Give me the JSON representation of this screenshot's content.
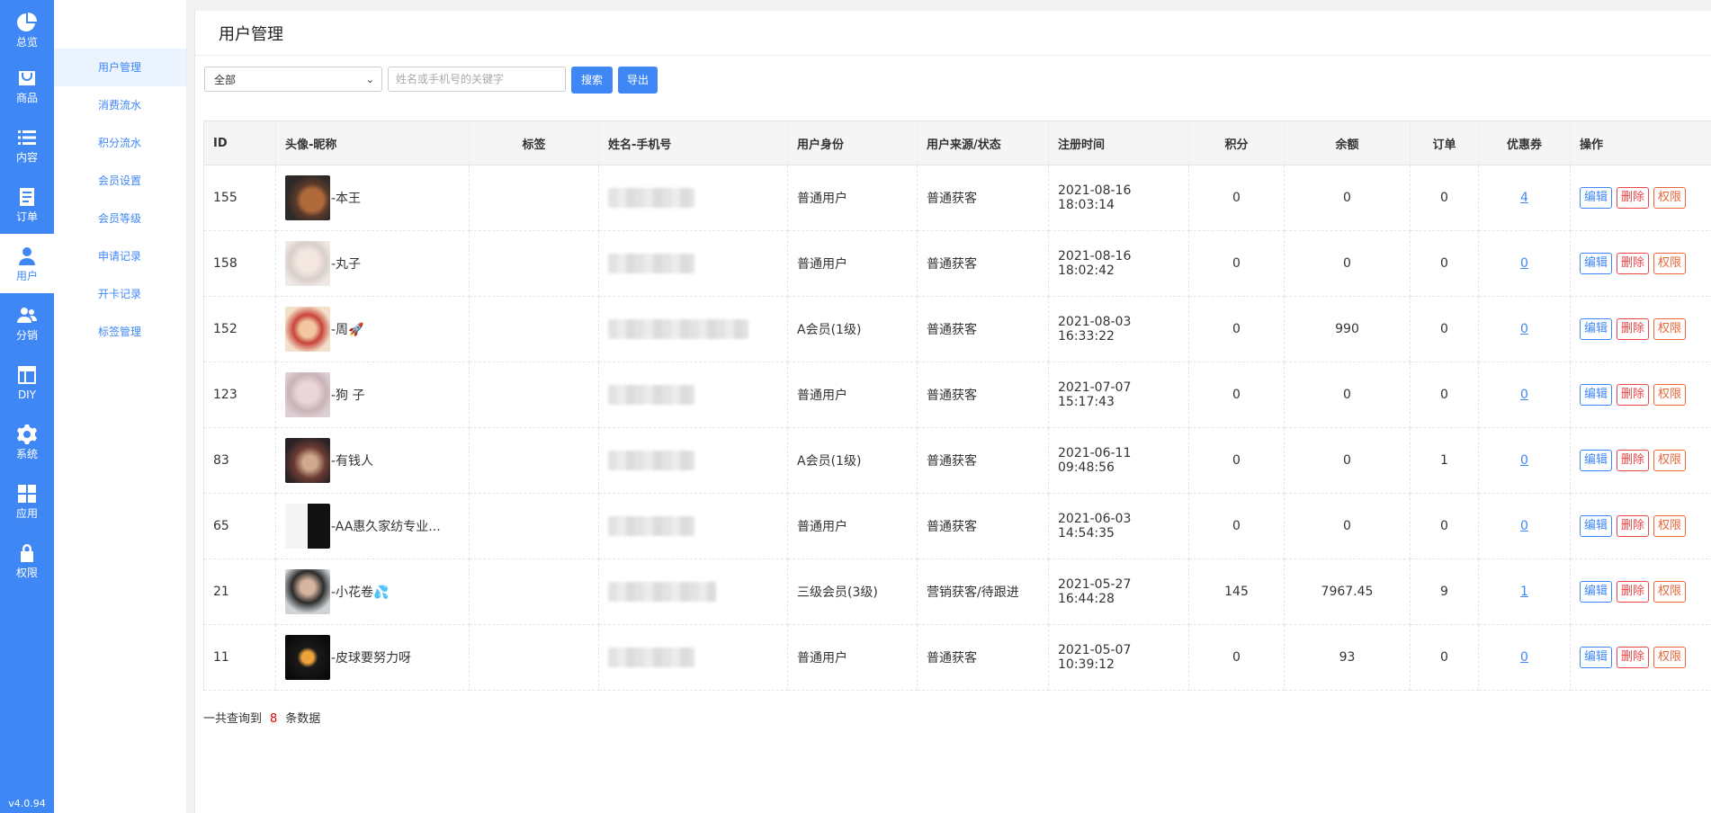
{
  "nav": {
    "items": [
      {
        "label": "总览",
        "icon": "dashboard-icon"
      },
      {
        "label": "商品",
        "icon": "goods-icon"
      },
      {
        "label": "内容",
        "icon": "list-icon"
      },
      {
        "label": "订单",
        "icon": "order-icon"
      },
      {
        "label": "用户",
        "icon": "user-icon",
        "active": true
      },
      {
        "label": "分销",
        "icon": "team-icon"
      },
      {
        "label": "DIY",
        "icon": "layout-icon"
      },
      {
        "label": "系统",
        "icon": "gear-icon"
      },
      {
        "label": "应用",
        "icon": "apps-icon"
      },
      {
        "label": "权限",
        "icon": "lock-icon"
      }
    ],
    "version": "v4.0.94",
    "accent": "#3f87f5"
  },
  "submenu": {
    "items": [
      "用户管理",
      "消费流水",
      "积分流水",
      "会员设置",
      "会员等级",
      "申请记录",
      "开卡记录",
      "标签管理"
    ]
  },
  "page": {
    "title": "用户管理",
    "filter_value": "全部",
    "search_placeholder": "姓名或手机号的关键字",
    "search_label": "搜索",
    "export_label": "导出"
  },
  "table": {
    "headers": [
      "ID",
      "头像-昵称",
      "标签",
      "姓名-手机号",
      "用户身份",
      "用户来源/状态",
      "注册时间",
      "积分",
      "余额",
      "订单",
      "优惠券",
      "操作"
    ],
    "actions": {
      "edit": "编辑",
      "delete": "删除",
      "perm": "权限"
    },
    "rows": [
      {
        "id": "155",
        "nick": "-本王",
        "role": "普通用户",
        "source": "普通获客",
        "time": "2021-08-16 18:03:14",
        "points": "0",
        "balance": "0",
        "orders": "0",
        "coupons": "4"
      },
      {
        "id": "158",
        "nick": "-丸子",
        "role": "普通用户",
        "source": "普通获客",
        "time": "2021-08-16 18:02:42",
        "points": "0",
        "balance": "0",
        "orders": "0",
        "coupons": "0"
      },
      {
        "id": "152",
        "nick": "-周🚀",
        "role": "A会员(1级)",
        "source": "普通获客",
        "time": "2021-08-03 16:33:22",
        "points": "0",
        "balance": "990",
        "orders": "0",
        "coupons": "0"
      },
      {
        "id": "123",
        "nick": "-狗 子",
        "role": "普通用户",
        "source": "普通获客",
        "time": "2021-07-07 15:17:43",
        "points": "0",
        "balance": "0",
        "orders": "0",
        "coupons": "0"
      },
      {
        "id": "83",
        "nick": "-有钱人",
        "role": "A会员(1级)",
        "source": "普通获客",
        "time": "2021-06-11 09:48:56",
        "points": "0",
        "balance": "0",
        "orders": "1",
        "coupons": "0"
      },
      {
        "id": "65",
        "nick": "-AA惠久家纺专业...",
        "role": "普通用户",
        "source": "普通获客",
        "time": "2021-06-03 14:54:35",
        "points": "0",
        "balance": "0",
        "orders": "0",
        "coupons": "0"
      },
      {
        "id": "21",
        "nick": "-小花卷💦",
        "role": "三级会员(3级)",
        "source": "营销获客/待跟进",
        "time": "2021-05-27 16:44:28",
        "points": "145",
        "balance": "7967.45",
        "orders": "9",
        "coupons": "1"
      },
      {
        "id": "11",
        "nick": "-皮球要努力呀",
        "role": "普通用户",
        "source": "普通获客",
        "time": "2021-05-07 10:39:12",
        "points": "0",
        "balance": "93",
        "orders": "0",
        "coupons": "0"
      }
    ]
  },
  "summary": {
    "prefix": "一共查询到",
    "count": "8",
    "suffix": "条数据"
  }
}
